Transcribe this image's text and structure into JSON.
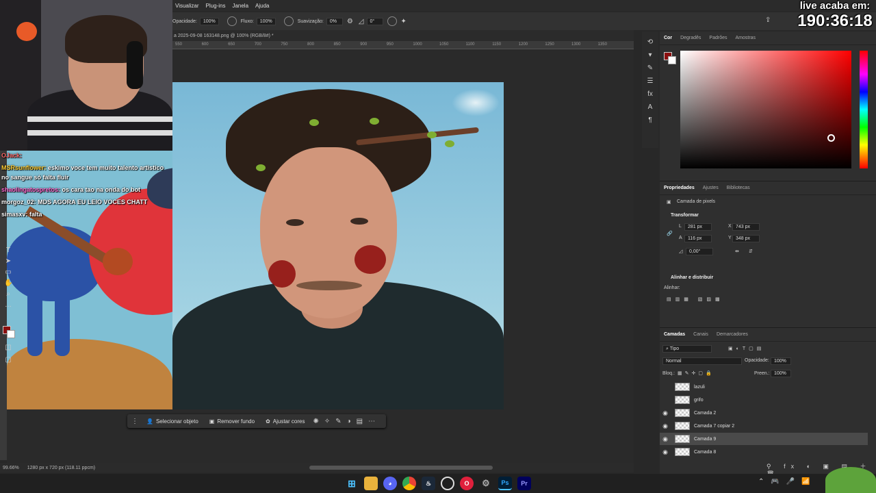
{
  "menu": [
    "Visualizar",
    "Plug-ins",
    "Janela",
    "Ajuda"
  ],
  "options": {
    "opacity_label": "Opacidade:",
    "opacity_value": "100%",
    "flow_label": "Fluxo:",
    "flow_value": "100%",
    "smooth_label": "Suavização:",
    "smooth_value": "0%",
    "angle_value": "0°"
  },
  "doc_tab": "a 2025-09-08 163148.png @ 100% (RGB/8#) *",
  "ruler": [
    "550",
    "600",
    "650",
    "700",
    "750",
    "800",
    "850",
    "900",
    "950",
    "1000",
    "1050",
    "1100",
    "1150",
    "1200",
    "1250",
    "1300",
    "1350"
  ],
  "chat": [
    {
      "user": "OJack:",
      "text": "",
      "color": "#ff6b6b"
    },
    {
      "user": "MSRsunflower:",
      "text": "eskimo voce tem muito talento artistico no sangue só falta fluir",
      "color": "#ffcc33"
    },
    {
      "user": "shaolingatospretos:",
      "text": "os cara tao na onda do bot",
      "color": "#ff6bd0"
    },
    {
      "user": "morgoz_02:",
      "text": "MDS AGORA EU LEIO VOCES CHATT",
      "color": "#ffffff"
    },
    {
      "user": "simasxv:",
      "text": "falta",
      "color": "#ffffff"
    }
  ],
  "context_bar": {
    "select_subject": "Selecionar objeto",
    "remove_bg": "Remover fundo",
    "adjust_colors": "Ajustar cores"
  },
  "status": {
    "zoom": "99.66%",
    "doc_info": "1280 px x 720 px (118.11 ppcm)"
  },
  "color_panel": {
    "tabs": [
      "Cor",
      "Degradês",
      "Padrões",
      "Amostras"
    ]
  },
  "properties": {
    "tabs": [
      "Propriedades",
      "Ajustes",
      "Bibliotecas"
    ],
    "layer_type": "Camada de pixels",
    "transform_title": "Transformar",
    "w_label": "L",
    "w_value": "281 px",
    "h_label": "A",
    "h_value": "116 px",
    "x_label": "X",
    "x_value": "743 px",
    "y_label": "Y",
    "y_value": "348 px",
    "angle_value": "0,00°",
    "align_title": "Alinhar e distribuir",
    "align_label": "Alinhar:"
  },
  "layers_panel": {
    "tabs": [
      "Camadas",
      "Canais",
      "Demarcadores"
    ],
    "filter": "Tipo",
    "blend": "Normal",
    "opacity_label": "Opacidade:",
    "opacity_value": "100%",
    "lock_label": "Bloq.:",
    "fill_label": "Preen.:",
    "fill_value": "100%",
    "layers": [
      {
        "name": "lazuli",
        "visible": false
      },
      {
        "name": "grifo",
        "visible": false
      },
      {
        "name": "Camada 2",
        "visible": true
      },
      {
        "name": "Camada 7 copiar 2",
        "visible": true
      },
      {
        "name": "Camada 9",
        "visible": true,
        "selected": true
      },
      {
        "name": "Camada 8",
        "visible": true
      }
    ]
  },
  "timer": {
    "line1": "live acaba em:",
    "line2": "190:36:18"
  },
  "colors": {
    "foreground": "#8b0f0f",
    "accent": "#2680eb"
  }
}
